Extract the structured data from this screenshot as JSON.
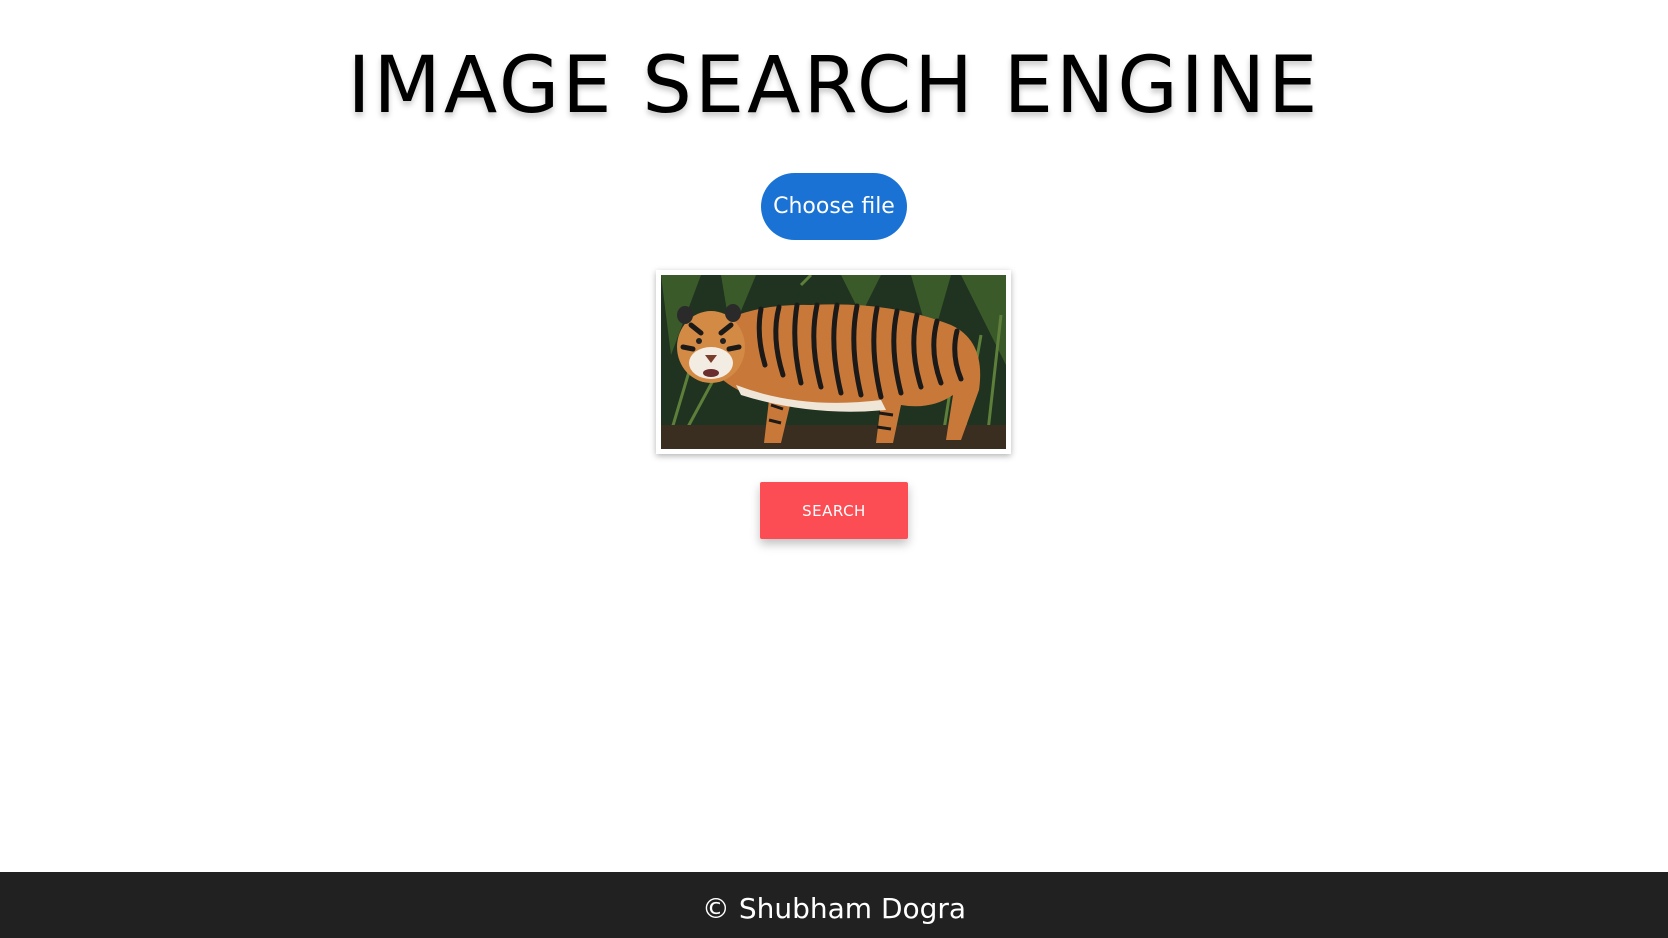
{
  "header": {
    "title": "IMAGE SEARCH ENGINE"
  },
  "upload": {
    "choose_file_label": "Choose file"
  },
  "preview": {
    "subject": "tiger photo"
  },
  "actions": {
    "search_label": "SEARCH"
  },
  "footer": {
    "copyright": "© Shubham Dogra"
  },
  "colors": {
    "choose_file_bg": "#1a73d4",
    "search_bg": "#fc4d55",
    "footer_bg": "#212121",
    "text": "#000000"
  }
}
